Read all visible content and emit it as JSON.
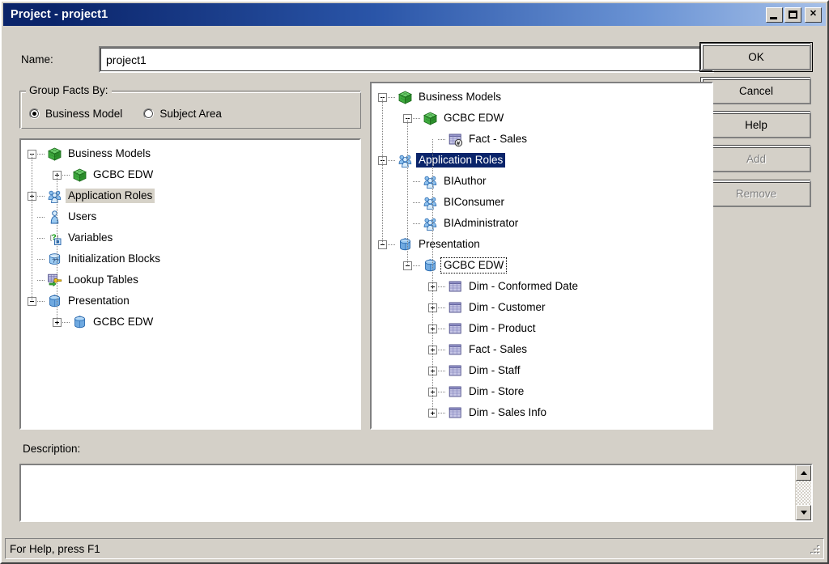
{
  "window": {
    "title": "Project - project1",
    "controls": [
      {
        "name": "minimize",
        "glyph": "_"
      },
      {
        "name": "maximize",
        "glyph": "□"
      },
      {
        "name": "close",
        "glyph": "✕"
      }
    ]
  },
  "form": {
    "name_label": "Name:",
    "name_value": "project1",
    "name_placeholder": "",
    "description_label": "Description:",
    "description_value": "",
    "description_placeholder": ""
  },
  "groupbox": {
    "legend": "Group Facts By:",
    "options": [
      {
        "label": "Business Model",
        "selected": true
      },
      {
        "label": "Subject Area",
        "selected": false
      }
    ]
  },
  "buttons": [
    {
      "id": "ok",
      "label": "OK",
      "default": true,
      "disabled": false
    },
    {
      "id": "cancel",
      "label": "Cancel",
      "default": false,
      "disabled": false
    },
    {
      "id": "help",
      "label": "Help",
      "default": false,
      "disabled": false
    },
    {
      "id": "add",
      "label": "Add",
      "default": false,
      "disabled": true
    },
    {
      "id": "remove",
      "label": "Remove",
      "default": false,
      "disabled": true
    }
  ],
  "left_tree": {
    "nodes": [
      {
        "label": "Business Models",
        "level": 0,
        "toggle": "minus",
        "icon": "green-cube-icon",
        "select": "none"
      },
      {
        "label": "GCBC EDW",
        "level": 1,
        "toggle": "plus",
        "icon": "green-cube-icon",
        "select": "none"
      },
      {
        "label": "Application Roles",
        "level": 0,
        "toggle": "plus",
        "icon": "app-roles-icon",
        "select": "inactive"
      },
      {
        "label": "Users",
        "level": 0,
        "toggle": "none",
        "icon": "user-icon",
        "select": "none"
      },
      {
        "label": "Variables",
        "level": 0,
        "toggle": "none",
        "icon": "variables-icon",
        "select": "none"
      },
      {
        "label": "Initialization Blocks",
        "level": 0,
        "toggle": "none",
        "icon": "init-block-icon",
        "select": "none"
      },
      {
        "label": "Lookup Tables",
        "level": 0,
        "toggle": "none",
        "icon": "lookup-table-icon",
        "select": "none"
      },
      {
        "label": "Presentation",
        "level": 0,
        "toggle": "minus",
        "icon": "blue-cube-icon",
        "select": "none"
      },
      {
        "label": "GCBC EDW",
        "level": 1,
        "toggle": "plus",
        "icon": "blue-cube-icon",
        "select": "none"
      }
    ]
  },
  "right_tree": {
    "nodes": [
      {
        "label": "Business Models",
        "level": 0,
        "toggle": "minus",
        "icon": "green-cube-icon",
        "select": "none"
      },
      {
        "label": "GCBC EDW",
        "level": 1,
        "toggle": "minus",
        "icon": "green-cube-icon",
        "select": "none"
      },
      {
        "label": "Fact - Sales",
        "level": 2,
        "toggle": "none",
        "icon": "fact-table-icon",
        "select": "none"
      },
      {
        "label": "Application Roles",
        "level": 0,
        "toggle": "minus",
        "icon": "app-roles-icon",
        "select": "active"
      },
      {
        "label": "BIAuthor",
        "level": 1,
        "toggle": "none",
        "icon": "app-roles-icon",
        "select": "none"
      },
      {
        "label": "BIConsumer",
        "level": 1,
        "toggle": "none",
        "icon": "app-roles-icon",
        "select": "none"
      },
      {
        "label": "BIAdministrator",
        "level": 1,
        "toggle": "none",
        "icon": "app-roles-icon",
        "select": "none"
      },
      {
        "label": "Presentation",
        "level": 0,
        "toggle": "minus",
        "icon": "blue-cube-icon",
        "select": "none"
      },
      {
        "label": "GCBC EDW",
        "level": 1,
        "toggle": "minus",
        "icon": "blue-cube-icon",
        "select": "focus"
      },
      {
        "label": "Dim - Conformed Date",
        "level": 2,
        "toggle": "plus",
        "icon": "table-icon",
        "select": "none"
      },
      {
        "label": "Dim - Customer",
        "level": 2,
        "toggle": "plus",
        "icon": "table-icon",
        "select": "none"
      },
      {
        "label": "Dim - Product",
        "level": 2,
        "toggle": "plus",
        "icon": "table-icon",
        "select": "none"
      },
      {
        "label": "Fact - Sales",
        "level": 2,
        "toggle": "plus",
        "icon": "table-icon",
        "select": "none"
      },
      {
        "label": "Dim - Staff",
        "level": 2,
        "toggle": "plus",
        "icon": "table-icon",
        "select": "none"
      },
      {
        "label": "Dim - Store",
        "level": 2,
        "toggle": "plus",
        "icon": "table-icon",
        "select": "none"
      },
      {
        "label": "Dim - Sales Info",
        "level": 2,
        "toggle": "plus",
        "icon": "table-icon",
        "select": "none"
      }
    ]
  },
  "scrollbar": {
    "up_icon": "scroll-up-arrow-icon",
    "down_icon": "scroll-down-arrow-icon"
  },
  "statusbar": {
    "text": "For Help, press F1"
  },
  "colors": {
    "titlebar_start": "#0a246a",
    "titlebar_end": "#a6c0e8",
    "dialog_face": "#d4d0c8",
    "selection_active": "#0a246a",
    "selection_inactive": "#d6d2c8",
    "field_bg": "#ffffff",
    "disabled_text": "#808080"
  }
}
